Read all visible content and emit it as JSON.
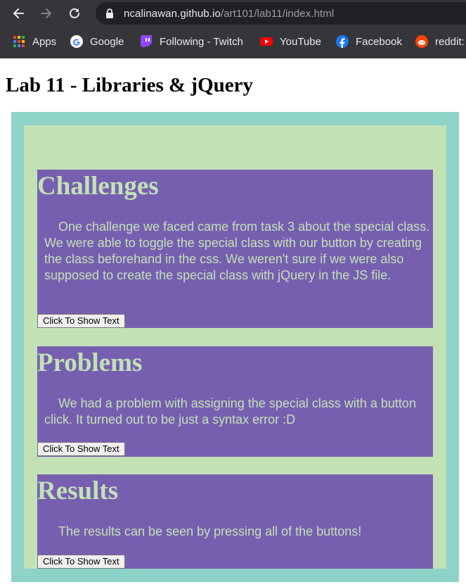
{
  "browser": {
    "url_host": "ncalinawan.github.io",
    "url_path": "/art101/lab11/index.html",
    "bookmarks": [
      {
        "label": "Apps",
        "icon": "apps-grid-icon"
      },
      {
        "label": "Google",
        "icon": "google-icon"
      },
      {
        "label": "Following - Twitch",
        "icon": "twitch-icon"
      },
      {
        "label": "YouTube",
        "icon": "youtube-icon"
      },
      {
        "label": "Facebook",
        "icon": "facebook-icon"
      },
      {
        "label": "reddit:",
        "icon": "reddit-icon"
      }
    ]
  },
  "page": {
    "title": "Lab 11 - Libraries & jQuery",
    "sections": [
      {
        "heading": "Challenges",
        "text": "One challenge we faced came from task 3 about the special class. We were able to toggle the special class with our button by creating the class beforehand in the css. We weren't sure if we were also supposed to create the special class with jQuery in the JS file.",
        "button": "Click To Show Text"
      },
      {
        "heading": "Problems",
        "text": "We had a problem with assigning the special class with a button click. It turned out to be just a syntax error :D",
        "button": "Click To Show Text"
      },
      {
        "heading": "Results",
        "text": "The results can be seen by pressing all of the buttons!",
        "button": "Click To Show Text"
      }
    ]
  },
  "colors": {
    "chrome_bg": "#35363a",
    "omnibox_bg": "#202124",
    "outer_box": "#8ed3c7",
    "inner_box": "#c2e2b6",
    "section_bg": "#775fb0",
    "section_text": "#c2e2b6"
  }
}
